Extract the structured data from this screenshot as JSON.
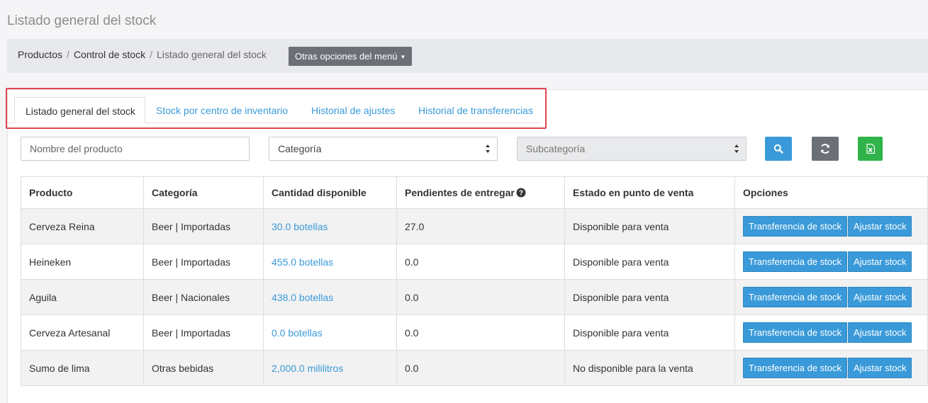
{
  "page_title": "Listado general del stock",
  "breadcrumb": {
    "items": [
      "Productos",
      "Control de stock"
    ],
    "separator": "/",
    "current": "Listado general del stock"
  },
  "menu_button": {
    "label": "Otras opciones del menú",
    "icon": "caret-down-icon"
  },
  "tabs": [
    {
      "label": "Listado general del stock",
      "active": true
    },
    {
      "label": "Stock por centro de inventario",
      "active": false
    },
    {
      "label": "Historial de ajustes",
      "active": false
    },
    {
      "label": "Historial de transferencias",
      "active": false
    }
  ],
  "filters": {
    "product_placeholder": "Nombre del producto",
    "category_value": "Categoría",
    "subcategory_value": "Subcategoría",
    "search_icon": "search-icon",
    "refresh_icon": "refresh-icon",
    "excel_icon": "excel-icon"
  },
  "colors": {
    "accent": "#3a9ad9",
    "highlight": "#e0464f",
    "search_btn": "#3a9ad9",
    "refresh_btn": "#6b6f76",
    "excel_btn": "#2fb34a"
  },
  "table": {
    "headers": [
      "Producto",
      "Categoría",
      "Cantidad disponible",
      "Pendientes de entregar",
      "Estado en punto de venta",
      "Opciones"
    ],
    "rows": [
      {
        "product": "Cerveza Reina",
        "category": "Beer | Importadas",
        "quantity": "30.0 botellas",
        "pending": "27.0",
        "status": "Disponible para venta"
      },
      {
        "product": "Heineken",
        "category": "Beer | Importadas",
        "quantity": "455.0 botellas",
        "pending": "0.0",
        "status": "Disponible para venta"
      },
      {
        "product": "Aguila",
        "category": "Beer | Nacionales",
        "quantity": "438.0 botellas",
        "pending": "0.0",
        "status": "Disponible para venta"
      },
      {
        "product": "Cerveza Artesanal",
        "category": "Beer | Importadas",
        "quantity": "0.0 botellas",
        "pending": "0.0",
        "status": "Disponible para venta"
      },
      {
        "product": "Sumo de lima",
        "category": "Otras bebidas",
        "quantity": "2,000.0 mililitros",
        "pending": "0.0",
        "status": "No disponible para la venta"
      }
    ],
    "actions": {
      "transfer_label": "Transferencia de stock",
      "adjust_label": "Ajustar stock"
    }
  }
}
